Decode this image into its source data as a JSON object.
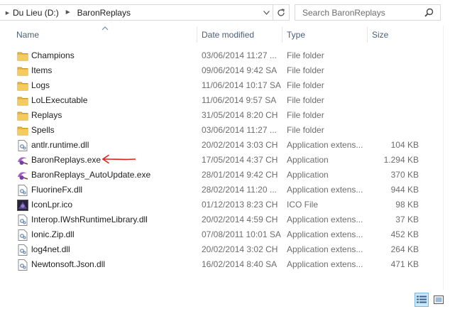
{
  "address": {
    "crumbs": [
      "Du Lieu (D:)",
      "BaronReplays"
    ],
    "dropdown_icon": "chevron-down-icon",
    "refresh_icon": "refresh-icon"
  },
  "search": {
    "placeholder": "Search BaronReplays",
    "icon": "search-icon"
  },
  "columns": {
    "name": "Name",
    "date": "Date modified",
    "type": "Type",
    "size": "Size"
  },
  "files": [
    {
      "name": "Champions",
      "date": "03/06/2014 11:27 ...",
      "type": "File folder",
      "size": "",
      "icon": "folder"
    },
    {
      "name": "Items",
      "date": "09/06/2014 9:42 SA",
      "type": "File folder",
      "size": "",
      "icon": "folder"
    },
    {
      "name": "Logs",
      "date": "11/06/2014 10:17 SA",
      "type": "File folder",
      "size": "",
      "icon": "folder"
    },
    {
      "name": "LoLExecutable",
      "date": "11/06/2014 9:57 SA",
      "type": "File folder",
      "size": "",
      "icon": "folder"
    },
    {
      "name": "Replays",
      "date": "31/05/2014 8:20 CH",
      "type": "File folder",
      "size": "",
      "icon": "folder"
    },
    {
      "name": "Spells",
      "date": "03/06/2014 11:27 ...",
      "type": "File folder",
      "size": "",
      "icon": "folder"
    },
    {
      "name": "antlr.runtime.dll",
      "date": "20/02/2014 3:03 CH",
      "type": "Application extens...",
      "size": "104 KB",
      "icon": "dll"
    },
    {
      "name": "BaronReplays.exe",
      "date": "17/05/2014 4:37 CH",
      "type": "Application",
      "size": "1.294 KB",
      "icon": "exe"
    },
    {
      "name": "BaronReplays_AutoUpdate.exe",
      "date": "28/01/2014 9:42 CH",
      "type": "Application",
      "size": "370 KB",
      "icon": "exe"
    },
    {
      "name": "FluorineFx.dll",
      "date": "28/02/2014 11:20 ...",
      "type": "Application extens...",
      "size": "944 KB",
      "icon": "dll"
    },
    {
      "name": "IconLpr.ico",
      "date": "01/12/2013 8:23 CH",
      "type": "ICO File",
      "size": "98 KB",
      "icon": "ico"
    },
    {
      "name": "Interop.IWshRuntimeLibrary.dll",
      "date": "20/02/2014 4:59 CH",
      "type": "Application extens...",
      "size": "37 KB",
      "icon": "dll"
    },
    {
      "name": "Ionic.Zip.dll",
      "date": "07/08/2011 10:01 SA",
      "type": "Application extens...",
      "size": "452 KB",
      "icon": "dll"
    },
    {
      "name": "log4net.dll",
      "date": "20/02/2014 3:02 CH",
      "type": "Application extens...",
      "size": "264 KB",
      "icon": "dll"
    },
    {
      "name": "Newtonsoft.Json.dll",
      "date": "16/02/2014 8:40 SA",
      "type": "Application extens...",
      "size": "471 KB",
      "icon": "dll"
    }
  ],
  "annotation": {
    "icon": "red-arrow-icon",
    "color": "#e0201c"
  },
  "view": {
    "details_icon": "details-view-icon",
    "tiles_icon": "large-icons-view-icon",
    "selected": "details"
  },
  "colors": {
    "folder": "#e8b84a",
    "header_text": "#4c607a",
    "meta_text": "#6d6d6d",
    "selected_view": "#cce8ff"
  }
}
